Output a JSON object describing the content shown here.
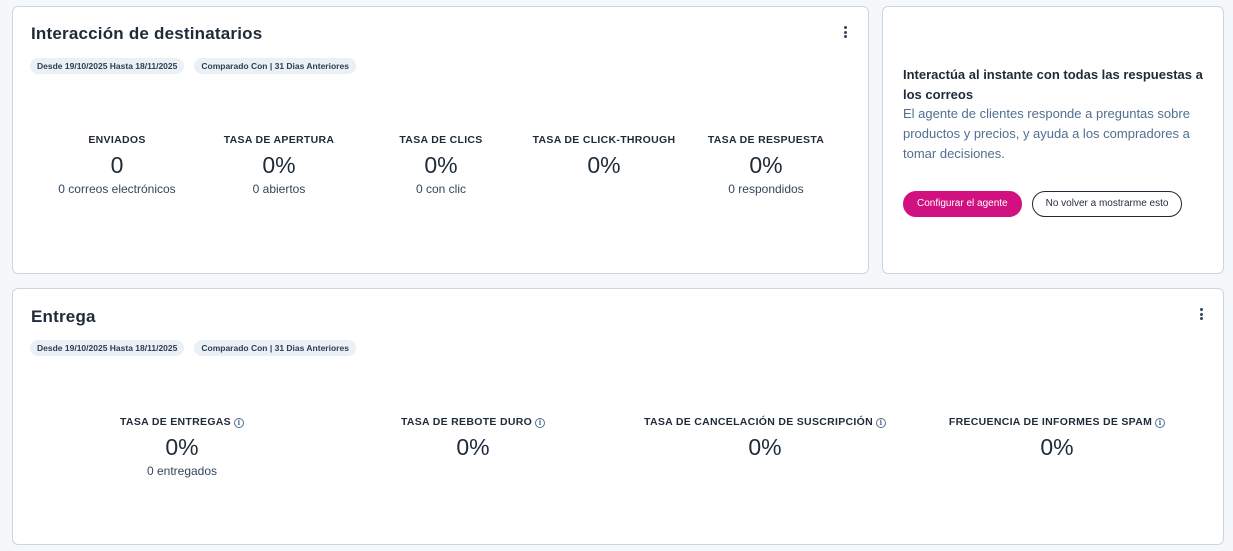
{
  "interaction": {
    "title": "Interacción de destinatarios",
    "date_range": "Desde 19/10/2025 Hasta 18/11/2025",
    "compared": "Comparado Con | 31 Dias Anteriores",
    "metrics": [
      {
        "label": "ENVIADOS",
        "value": "0",
        "sub": "0 correos electrónicos"
      },
      {
        "label": "TASA DE APERTURA",
        "value": "0%",
        "sub": "0 abiertos"
      },
      {
        "label": "TASA DE CLICS",
        "value": "0%",
        "sub": "0 con clic"
      },
      {
        "label": "TASA DE CLICK-THROUGH",
        "value": "0%",
        "sub": ""
      },
      {
        "label": "TASA DE RESPUESTA",
        "value": "0%",
        "sub": "0 respondidos"
      }
    ]
  },
  "promo": {
    "title": "Interactúa al instante con todas las respuestas a los correos",
    "body": "El agente de clientes responde a preguntas sobre productos y precios, y ayuda a los compradores a tomar decisiones.",
    "primary_label": "Configurar el agente",
    "secondary_label": "No volver a mostrarme esto",
    "accent_color": "#d1117f"
  },
  "delivery": {
    "title": "Entrega",
    "date_range": "Desde 19/10/2025 Hasta 18/11/2025",
    "compared": "Comparado Con | 31 Dias Anteriores",
    "metrics": [
      {
        "label": "TASA DE ENTREGAS",
        "value": "0%",
        "sub": "0 entregados"
      },
      {
        "label": "TASA DE REBOTE DURO",
        "value": "0%",
        "sub": ""
      },
      {
        "label": "TASA DE CANCELACIÓN DE SUSCRIPCIÓN",
        "value": "0%",
        "sub": ""
      },
      {
        "label": "FRECUENCIA DE INFORMES DE SPAM",
        "value": "0%",
        "sub": ""
      }
    ]
  },
  "icons": {
    "menu": "vertical-ellipsis-icon",
    "info": "info-circle-icon"
  }
}
